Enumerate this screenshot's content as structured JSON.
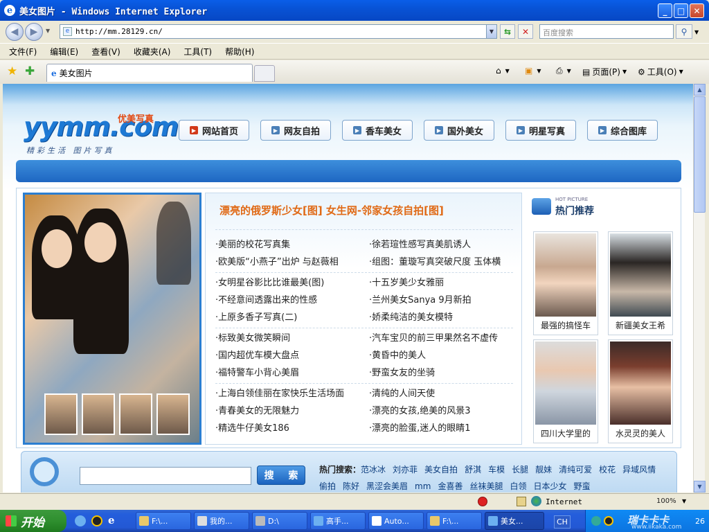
{
  "window": {
    "title": "美女图片 - Windows Internet Explorer",
    "url": "http://mm.28129.cn/",
    "search_placeholder": "百度搜索"
  },
  "menu": [
    "文件(F)",
    "编辑(E)",
    "查看(V)",
    "收藏夹(A)",
    "工具(T)",
    "帮助(H)"
  ],
  "tab": {
    "label": "美女图片"
  },
  "commands": {
    "page": "页面(P)",
    "tools": "工具(O)"
  },
  "site": {
    "logo": "yymm.com",
    "logo_tag": "优美写真",
    "logo_sub": "精彩生活 图片写真",
    "nav": [
      "网站首页",
      "网友自拍",
      "香车美女",
      "国外美女",
      "明星写真",
      "综合图库"
    ],
    "headline": "漂亮的俄罗斯少女[图]  女生网-邻家女孩自拍[图]",
    "groups": [
      {
        "left": [
          "·美丽的校花写真集",
          "·欧美版“小燕子”出炉 与赵薇相"
        ],
        "right": [
          "·徐若瑄性感写真美肌诱人",
          "·组图：董璇写真突破尺度 玉体横"
        ]
      },
      {
        "left": [
          "·女明星谷影比比谁最美(图)",
          "·不经意间透露出来的性感",
          "·上原多香子写真(二)"
        ],
        "right": [
          "·十五岁美少女雅丽",
          "·兰州美女Sanya 9月新拍",
          "·娇柔纯洁的美女模特"
        ]
      },
      {
        "left": [
          "·标致美女微笑瞬间",
          "·国内超优车模大盘点",
          "·福特警车小背心美眉"
        ],
        "right": [
          "·汽车宝贝的前三甲果然名不虚传",
          "·黄昏中的美人",
          "·野蛮女友的坐骑"
        ]
      },
      {
        "left": [
          "·上海白领佳丽在家快乐生活场面",
          "·青春美女的无限魅力",
          "·精选牛仔美女186"
        ],
        "right": [
          "·清纯的人间天使",
          "·漂亮的女孩,绝美的风景3",
          "·漂亮的脸蛋,迷人的眼睛1"
        ]
      }
    ],
    "hot_small": "HOT PICTURE",
    "hot_title": "热门推荐",
    "hot_items": [
      "最强的搞怪车",
      "新疆美女王希",
      "四川大学里的",
      "水灵灵的美人"
    ],
    "search_button": "搜 索",
    "hot_label": "热门搜索：",
    "hot_keywords": [
      "范冰冰",
      "刘亦菲",
      "美女自拍",
      "舒淇",
      "车模",
      "长腿",
      "靓妹",
      "清纯可爱",
      "校花",
      "异域风情",
      "偷拍",
      "陈好",
      "黑涩会美眉",
      "mm",
      "金喜善",
      "丝袜美腿",
      "白领",
      "日本少女",
      "野蛮"
    ]
  },
  "status": {
    "zone": "Internet",
    "zoom": "100%"
  },
  "taskbar": {
    "start": "开始",
    "buttons": [
      "F:\\...",
      "我的...",
      "D:\\",
      "高手...",
      "Auto...",
      "F:\\...",
      "美女..."
    ],
    "lang": "CH",
    "clock": "26"
  },
  "watermark": "www.iikaka.com"
}
